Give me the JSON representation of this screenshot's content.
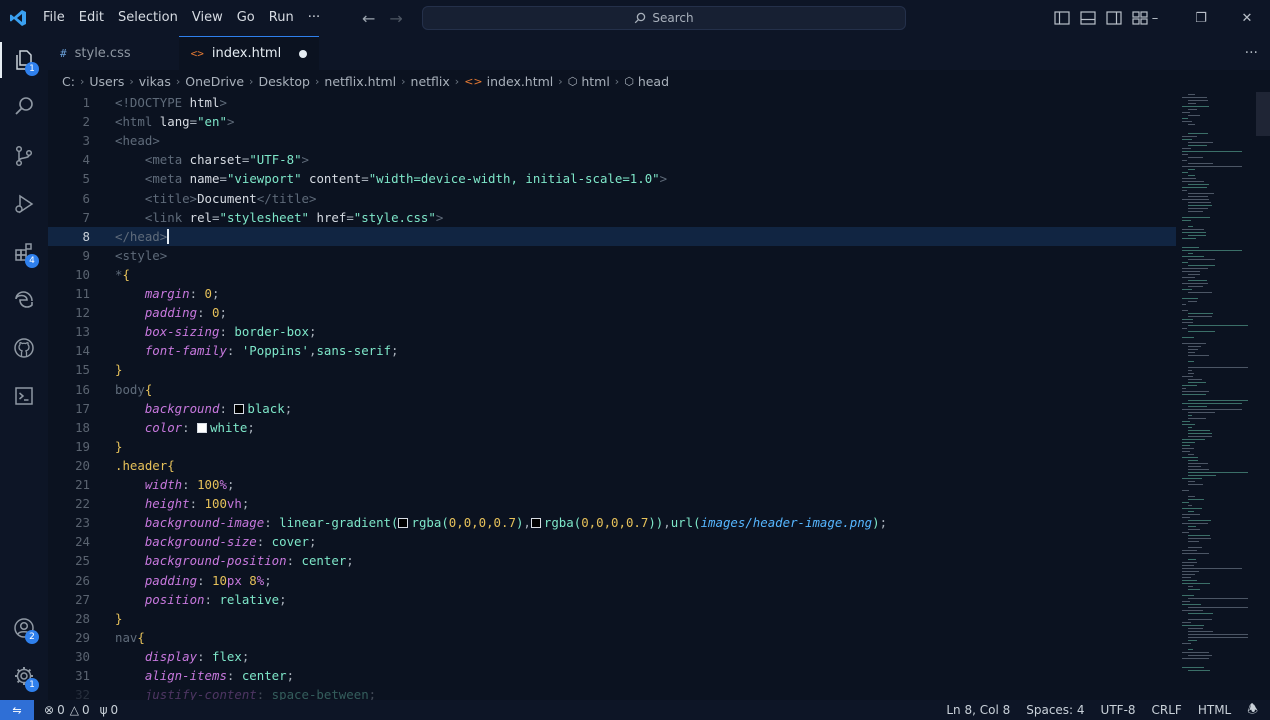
{
  "menu": [
    "File",
    "Edit",
    "Selection",
    "View",
    "Go",
    "Run",
    "···"
  ],
  "search": {
    "label": "Search"
  },
  "activity_badges": {
    "explorer": "1",
    "extensions": "4",
    "accounts": "2",
    "manage": "1"
  },
  "tabs": [
    {
      "label": "style.css",
      "icon": "#",
      "active": false
    },
    {
      "label": "index.html",
      "icon": "<>",
      "active": true,
      "dirty": true
    }
  ],
  "breadcrumb": [
    "C:",
    "Users",
    "vikas",
    "OneDrive",
    "Desktop",
    "netflix.html",
    "netflix",
    "index.html",
    "html",
    "head"
  ],
  "editor": {
    "current_line": 8,
    "lines": [
      {
        "n": "1",
        "tokens": [
          [
            "br",
            "<!"
          ],
          [
            "tag",
            "DOCTYPE "
          ],
          [
            "attr",
            "html"
          ],
          [
            "br",
            ">"
          ]
        ]
      },
      {
        "n": "2",
        "tokens": [
          [
            "br",
            "<"
          ],
          [
            "tag",
            "html "
          ],
          [
            "attr",
            "lang"
          ],
          [
            "punc",
            "="
          ],
          [
            "str",
            "\"en\""
          ],
          [
            "br",
            ">"
          ]
        ]
      },
      {
        "n": "3",
        "tokens": [
          [
            "br",
            "<"
          ],
          [
            "tag",
            "head"
          ],
          [
            "br",
            ">"
          ]
        ]
      },
      {
        "n": "4",
        "tokens": [
          [
            "ws",
            "    "
          ],
          [
            "br",
            "<"
          ],
          [
            "tag",
            "meta "
          ],
          [
            "attr",
            "charset"
          ],
          [
            "punc",
            "="
          ],
          [
            "str",
            "\"UTF-8\""
          ],
          [
            "br",
            ">"
          ]
        ]
      },
      {
        "n": "5",
        "tokens": [
          [
            "ws",
            "    "
          ],
          [
            "br",
            "<"
          ],
          [
            "tag",
            "meta "
          ],
          [
            "attr",
            "name"
          ],
          [
            "punc",
            "="
          ],
          [
            "str",
            "\"viewport\""
          ],
          [
            "txt",
            " "
          ],
          [
            "attr",
            "content"
          ],
          [
            "punc",
            "="
          ],
          [
            "str",
            "\"width=device-width, initial-scale=1.0\""
          ],
          [
            "br",
            ">"
          ]
        ]
      },
      {
        "n": "6",
        "tokens": [
          [
            "ws",
            "    "
          ],
          [
            "br",
            "<"
          ],
          [
            "tag",
            "title"
          ],
          [
            "br",
            ">"
          ],
          [
            "txt",
            "Document"
          ],
          [
            "br",
            "</"
          ],
          [
            "tag",
            "title"
          ],
          [
            "br",
            ">"
          ]
        ]
      },
      {
        "n": "7",
        "tokens": [
          [
            "ws",
            "    "
          ],
          [
            "br",
            "<"
          ],
          [
            "tag",
            "link "
          ],
          [
            "attr",
            "rel"
          ],
          [
            "punc",
            "="
          ],
          [
            "str",
            "\"stylesheet\""
          ],
          [
            "txt",
            " "
          ],
          [
            "attr",
            "href"
          ],
          [
            "punc",
            "="
          ],
          [
            "str",
            "\"style.css\""
          ],
          [
            "br",
            ">"
          ]
        ]
      },
      {
        "n": "8",
        "tokens": [
          [
            "br",
            "</"
          ],
          [
            "tag",
            "head"
          ],
          [
            "br",
            ">"
          ],
          [
            "caret",
            ""
          ]
        ]
      },
      {
        "n": "9",
        "tokens": [
          [
            "br",
            "<"
          ],
          [
            "tag",
            "style"
          ],
          [
            "br",
            ">"
          ]
        ]
      },
      {
        "n": "10",
        "tokens": [
          [
            "tag",
            "*"
          ],
          [
            "brace",
            "{"
          ]
        ]
      },
      {
        "n": "11",
        "tokens": [
          [
            "ws",
            "    "
          ],
          [
            "prop",
            "margin"
          ],
          [
            "punc",
            ": "
          ],
          [
            "num",
            "0"
          ],
          [
            "punc",
            ";"
          ]
        ]
      },
      {
        "n": "12",
        "tokens": [
          [
            "ws",
            "    "
          ],
          [
            "prop",
            "padding"
          ],
          [
            "punc",
            ": "
          ],
          [
            "num",
            "0"
          ],
          [
            "punc",
            ";"
          ]
        ]
      },
      {
        "n": "13",
        "tokens": [
          [
            "ws",
            "    "
          ],
          [
            "prop",
            "box-sizing"
          ],
          [
            "punc",
            ": "
          ],
          [
            "val",
            "border-box"
          ],
          [
            "punc",
            ";"
          ]
        ]
      },
      {
        "n": "14",
        "tokens": [
          [
            "ws",
            "    "
          ],
          [
            "prop",
            "font-family"
          ],
          [
            "punc",
            ": "
          ],
          [
            "val",
            "'Poppins'"
          ],
          [
            "punc",
            ","
          ],
          [
            "val",
            "sans-serif"
          ],
          [
            "punc",
            ";"
          ]
        ]
      },
      {
        "n": "15",
        "tokens": [
          [
            "brace",
            "}"
          ]
        ]
      },
      {
        "n": "16",
        "tokens": [
          [
            "tag",
            "body"
          ],
          [
            "brace",
            "{"
          ]
        ]
      },
      {
        "n": "17",
        "tokens": [
          [
            "ws",
            "    "
          ],
          [
            "prop",
            "background"
          ],
          [
            "punc",
            ": "
          ],
          [
            "swatch",
            "#000000"
          ],
          [
            "val",
            "black"
          ],
          [
            "punc",
            ";"
          ]
        ]
      },
      {
        "n": "18",
        "tokens": [
          [
            "ws",
            "    "
          ],
          [
            "prop",
            "color"
          ],
          [
            "punc",
            ": "
          ],
          [
            "swatch",
            "#ffffff"
          ],
          [
            "val",
            "white"
          ],
          [
            "punc",
            ";"
          ]
        ]
      },
      {
        "n": "19",
        "tokens": [
          [
            "brace",
            "}"
          ]
        ]
      },
      {
        "n": "20",
        "tokens": [
          [
            "sel",
            ".header"
          ],
          [
            "brace",
            "{"
          ]
        ]
      },
      {
        "n": "21",
        "tokens": [
          [
            "ws",
            "    "
          ],
          [
            "prop",
            "width"
          ],
          [
            "punc",
            ": "
          ],
          [
            "num",
            "100"
          ],
          [
            "unit",
            "%"
          ],
          [
            "punc",
            ";"
          ]
        ]
      },
      {
        "n": "22",
        "tokens": [
          [
            "ws",
            "    "
          ],
          [
            "prop",
            "height"
          ],
          [
            "punc",
            ": "
          ],
          [
            "num",
            "100"
          ],
          [
            "unit",
            "vh"
          ],
          [
            "punc",
            ";"
          ]
        ]
      },
      {
        "n": "23",
        "tokens": [
          [
            "ws",
            "    "
          ],
          [
            "prop",
            "background-image"
          ],
          [
            "punc",
            ": "
          ],
          [
            "fn",
            "linear-gradient("
          ],
          [
            "swatch",
            "#000000"
          ],
          [
            "fn",
            "rgba("
          ],
          [
            "num",
            "0,0,0,0.7"
          ],
          [
            "fn",
            ")"
          ],
          [
            "punc",
            ","
          ],
          [
            "swatch",
            "#000000"
          ],
          [
            "fn",
            "rgba("
          ],
          [
            "num",
            "0,0,0,0.7"
          ],
          [
            "fn",
            "))"
          ],
          [
            "punc",
            ","
          ],
          [
            "fn",
            "url("
          ],
          [
            "url",
            "images/header-image.png"
          ],
          [
            "fn",
            ")"
          ],
          [
            "punc",
            ";"
          ]
        ]
      },
      {
        "n": "24",
        "tokens": [
          [
            "ws",
            "    "
          ],
          [
            "prop",
            "background-size"
          ],
          [
            "punc",
            ": "
          ],
          [
            "val",
            "cover"
          ],
          [
            "punc",
            ";"
          ]
        ]
      },
      {
        "n": "25",
        "tokens": [
          [
            "ws",
            "    "
          ],
          [
            "prop",
            "background-position"
          ],
          [
            "punc",
            ": "
          ],
          [
            "val",
            "center"
          ],
          [
            "punc",
            ";"
          ]
        ]
      },
      {
        "n": "26",
        "tokens": [
          [
            "ws",
            "    "
          ],
          [
            "prop",
            "padding"
          ],
          [
            "punc",
            ": "
          ],
          [
            "num",
            "10"
          ],
          [
            "unit",
            "px "
          ],
          [
            "num",
            "8"
          ],
          [
            "unit",
            "%"
          ],
          [
            "punc",
            ";"
          ]
        ]
      },
      {
        "n": "27",
        "tokens": [
          [
            "ws",
            "    "
          ],
          [
            "prop",
            "position"
          ],
          [
            "punc",
            ": "
          ],
          [
            "val",
            "relative"
          ],
          [
            "punc",
            ";"
          ]
        ]
      },
      {
        "n": "28",
        "tokens": [
          [
            "brace",
            "}"
          ]
        ]
      },
      {
        "n": "29",
        "tokens": [
          [
            "tag",
            "nav"
          ],
          [
            "brace",
            "{"
          ]
        ]
      },
      {
        "n": "30",
        "tokens": [
          [
            "ws",
            "    "
          ],
          [
            "prop",
            "display"
          ],
          [
            "punc",
            ": "
          ],
          [
            "val",
            "flex"
          ],
          [
            "punc",
            ";"
          ]
        ]
      },
      {
        "n": "31",
        "tokens": [
          [
            "ws",
            "    "
          ],
          [
            "prop",
            "align-items"
          ],
          [
            "punc",
            ": "
          ],
          [
            "val",
            "center"
          ],
          [
            "punc",
            ";"
          ]
        ]
      },
      {
        "n": "32",
        "tokens": [
          [
            "ws",
            "    "
          ],
          [
            "prop",
            "justify-content"
          ],
          [
            "punc",
            ": "
          ],
          [
            "val",
            "space-between"
          ],
          [
            "punc",
            ";"
          ]
        ]
      }
    ]
  },
  "status": {
    "errors": "0",
    "warnings": "0",
    "ports": "0",
    "position": "Ln 8, Col 8",
    "spaces": "Spaces: 4",
    "encoding": "UTF-8",
    "eol": "CRLF",
    "language": "HTML"
  }
}
